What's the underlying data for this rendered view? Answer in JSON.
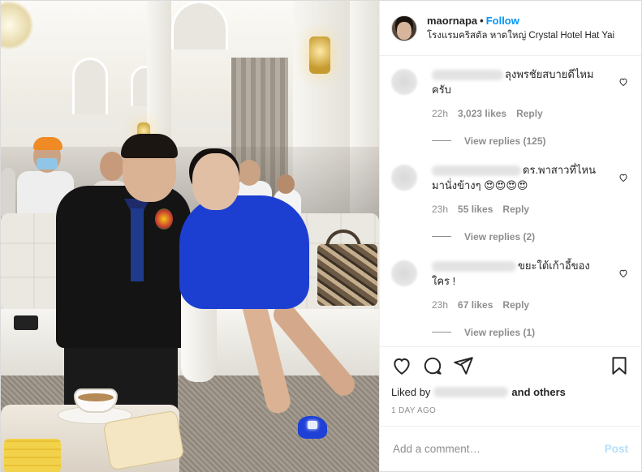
{
  "post": {
    "username": "maornapa",
    "separator": "•",
    "follow_label": "Follow",
    "location": "โรงแรมคริสตัล หาดใหญ่ Crystal Hotel Hat Yai"
  },
  "comments": [
    {
      "text": "ลุงพรชัยสบายดีไหม ครับ",
      "age": "22h",
      "likes": "3,023 likes",
      "reply_label": "Reply",
      "view_replies": "View replies (125)"
    },
    {
      "text": "ดร.พาสาวที่ไหนมานั่งข้างๆ 😍😍😍😍",
      "age": "23h",
      "likes": "55 likes",
      "reply_label": "Reply",
      "view_replies": "View replies (2)"
    },
    {
      "text": "ขยะใต้เก้าอี้ของ ใคร !",
      "age": "23h",
      "likes": "67 likes",
      "reply_label": "Reply",
      "view_replies": "View replies (1)"
    }
  ],
  "actions": {
    "liked_by_prefix": "Liked by",
    "liked_by_suffix": "and others",
    "time_ago": "1 DAY AGO"
  },
  "add_comment": {
    "placeholder": "Add a comment…",
    "post_label": "Post"
  },
  "colors": {
    "link_blue": "#0095f6",
    "post_disabled": "#b2dffc",
    "muted": "#8e8e8e"
  },
  "icons": {
    "heart": "heart-icon",
    "comment": "comment-icon",
    "share": "share-icon",
    "save": "bookmark-icon"
  }
}
